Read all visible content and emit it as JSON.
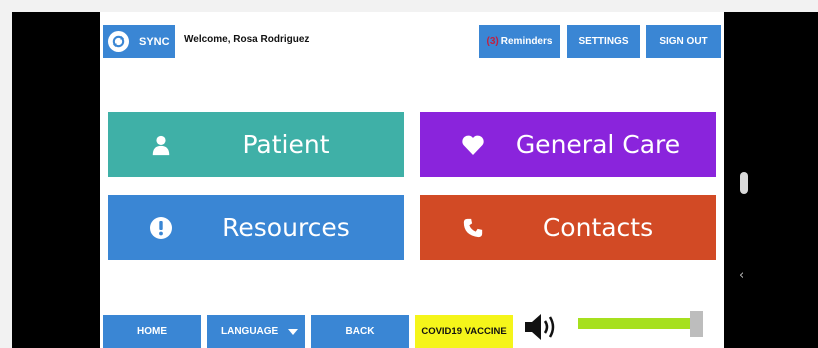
{
  "header": {
    "sync_label": "SYNC",
    "welcome": "Welcome, Rosa Rodriguez",
    "reminders_count": "(3)",
    "reminders_label": "Reminders",
    "settings_label": "SETTINGS",
    "signout_label": "SIGN OUT"
  },
  "tiles": {
    "patient": "Patient",
    "general_care": "General Care",
    "resources": "Resources",
    "contacts": "Contacts"
  },
  "footer": {
    "home": "HOME",
    "language": "LANGUAGE",
    "back": "BACK",
    "covid": "COVID19 VACCINE"
  },
  "volume": {
    "level": 0.97
  },
  "colors": {
    "blue": "#3a86d4",
    "teal": "#3fb0a7",
    "purple": "#8a24dc",
    "orange": "#d24a25",
    "yellow": "#f5f51a",
    "green": "#a6e01e"
  },
  "icons": {
    "sync": "sync-icon",
    "patient": "user-icon",
    "general_care": "heart-icon",
    "resources": "exclamation-icon",
    "contacts": "phone-icon",
    "volume": "speaker-icon"
  }
}
